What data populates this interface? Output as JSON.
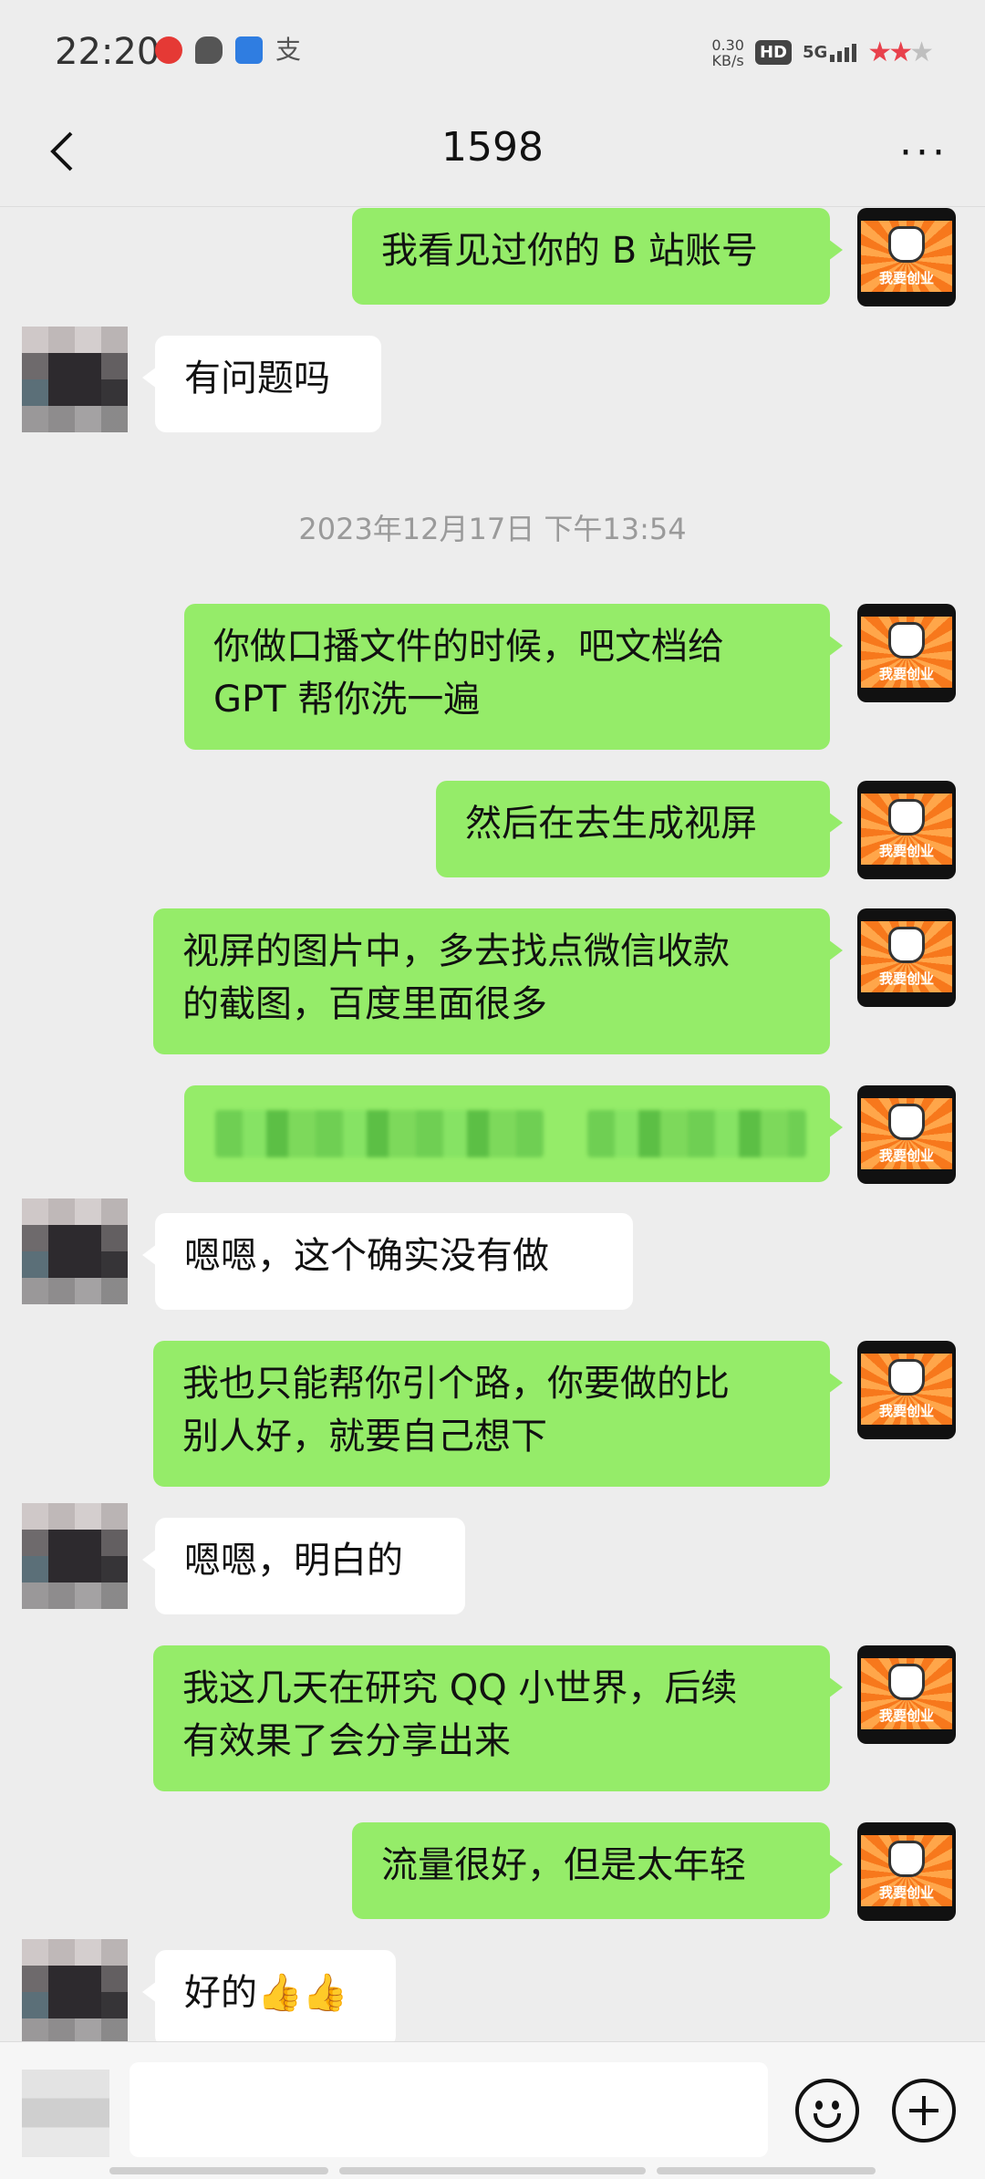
{
  "status_bar": {
    "time": "22:20",
    "notification_icons": [
      "weibo-icon",
      "chat-bubble-icon",
      "paw-icon",
      "alipay-icon"
    ],
    "alipay_glyph": "支",
    "net_speed_value": "0.30",
    "net_speed_unit": "KB/s",
    "hd_badge": "HD",
    "network": "5G",
    "rating_stars": "★★",
    "rating_dim_star": "★"
  },
  "nav": {
    "title": "1598",
    "more_label": "···"
  },
  "messages": [
    {
      "side": "out",
      "text": "我看见过你的 B 站账号"
    },
    {
      "side": "in",
      "text": "有问题吗"
    },
    {
      "side": "out",
      "line1": "你做口播文件的时候，吧文档给",
      "line2": "GPT 帮你洗一遍"
    },
    {
      "side": "out",
      "text": "然后在去生成视屏"
    },
    {
      "side": "out",
      "line1": "视屏的图片中，多去找点微信收款",
      "line2": "的截图，百度里面很多"
    },
    {
      "side": "in",
      "text": "嗯嗯，这个确实没有做"
    },
    {
      "side": "out",
      "line1": "我也只能帮你引个路，你要做的比",
      "line2": "别人好，就要自己想下"
    },
    {
      "side": "in",
      "text": "嗯嗯，明白的"
    },
    {
      "side": "out",
      "line1": "我这几天在研究 QQ 小世界，后续",
      "line2": "有效果了会分享出来"
    },
    {
      "side": "out",
      "text": "流量很好，但是太年轻"
    },
    {
      "side": "in",
      "text": "好的👍👍"
    }
  ],
  "timestamp": "2023年12月17日 下午13:54",
  "my_avatar_caption": "我要创业",
  "colors": {
    "outgoing_bubble": "#95ec69",
    "incoming_bubble": "#ffffff",
    "background": "#ededed"
  }
}
